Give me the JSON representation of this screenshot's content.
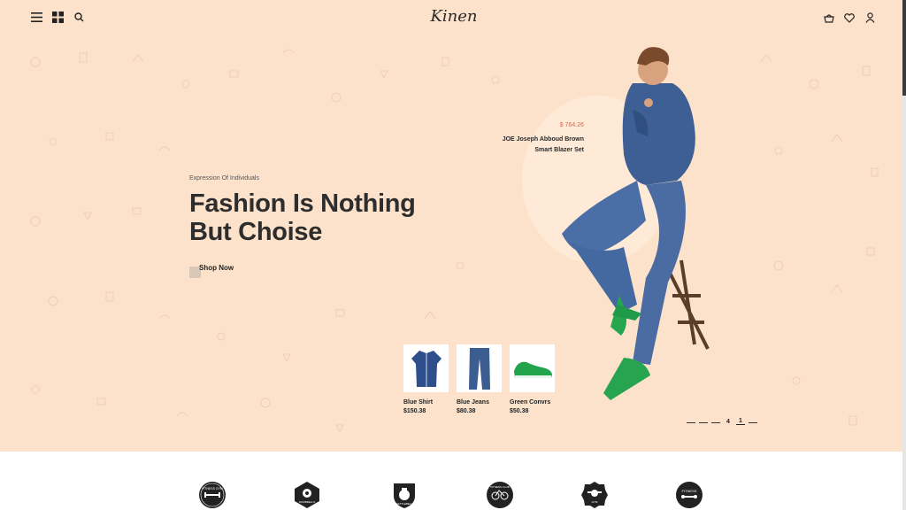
{
  "header": {
    "logo": "Kinen",
    "left_icons": [
      "menu-icon",
      "grid-icon",
      "search-icon"
    ],
    "right_icons": [
      "basket-icon",
      "heart-icon",
      "user-icon"
    ]
  },
  "hero": {
    "eyebrow": "Expression Of Individuals",
    "headline_line1": "Fashion Is Nothing",
    "headline_line2": "But Choise",
    "cta_label": "Shop Now",
    "featured": {
      "price": "$ 764.26",
      "name_line1": "JOE Joseph Abboud Brown",
      "name_line2": "Smart Blazer Set"
    },
    "products": [
      {
        "name": "Blue Shirt",
        "price": "$150.38"
      },
      {
        "name": "Blue Jeans",
        "price": "$80.38"
      },
      {
        "name": "Green Convrs",
        "price": "$50.38"
      }
    ],
    "pager": {
      "current": "4",
      "next": "1"
    }
  },
  "colors": {
    "hero_bg": "#fde2cb",
    "accent_price": "#e0664a",
    "text_dark": "#2d2d2d"
  },
  "brands": [
    "FITNESS GYM",
    "DUMBBELLS",
    "KETTLEBELL",
    "FITNESS CLUB",
    "GYM",
    "FITNESS"
  ]
}
